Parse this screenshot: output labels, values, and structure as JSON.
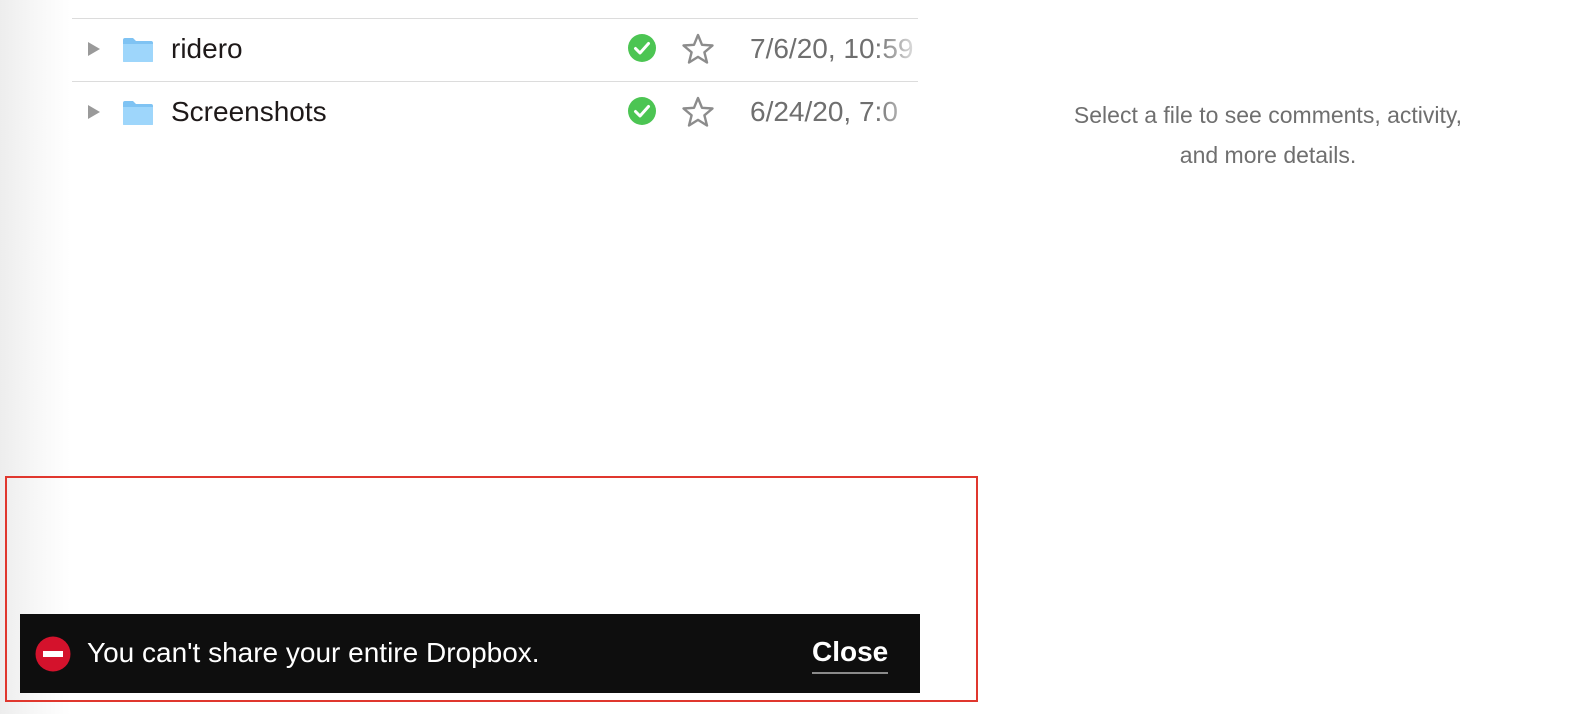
{
  "file_list": {
    "rows": [
      {
        "name": "ridero",
        "modified": "7/6/20, 10:59",
        "icon": "folder-icon",
        "sync_status": "synced",
        "starred": false
      },
      {
        "name": "Screenshots",
        "modified": "6/24/20, 7:0",
        "icon": "folder-icon",
        "sync_status": "synced",
        "starred": false
      }
    ]
  },
  "details_panel": {
    "line1": "Select a file to see comments, activity,",
    "line2": "and more details."
  },
  "snackbar": {
    "message": "You can't share your entire Dropbox.",
    "close_label": "Close",
    "icon": "error-minus-icon"
  },
  "colors": {
    "folder": "#8ecdf8",
    "sync_green": "#4cc553",
    "error_red": "#d4122c",
    "highlight_border": "#e0372e",
    "snackbar_bg": "#0e0e0e"
  }
}
